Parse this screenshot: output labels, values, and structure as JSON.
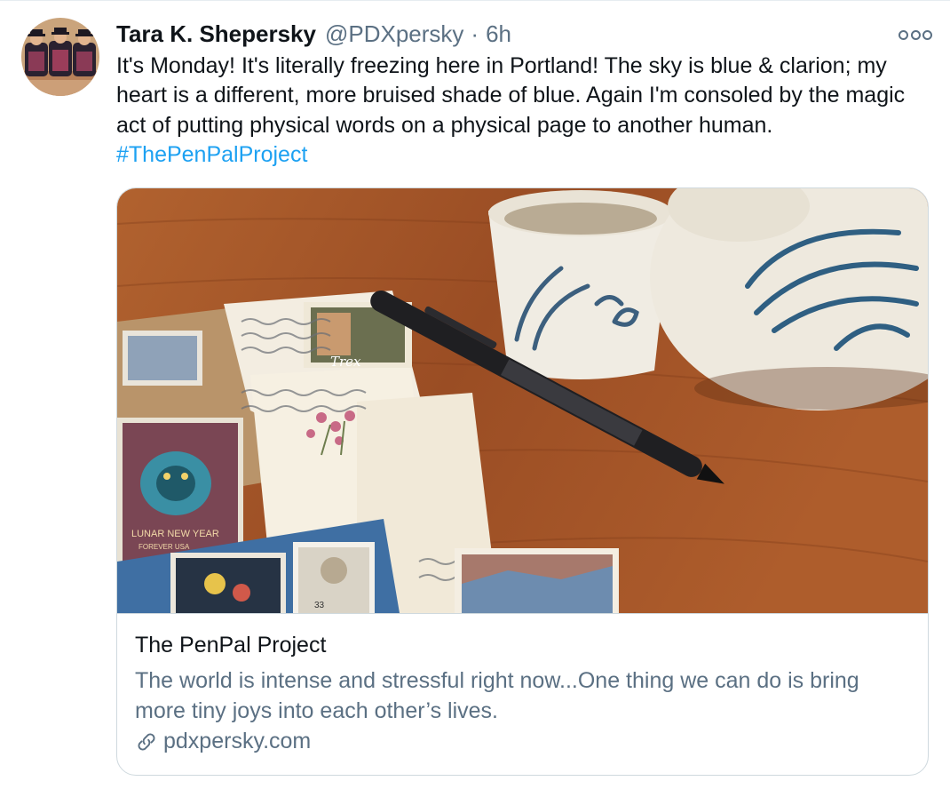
{
  "tweet": {
    "display_name": "Tara K. Shepersky",
    "handle": "@PDXpersky",
    "separator": "·",
    "timestamp": "6h",
    "text": "It's Monday! It's literally freezing here in Portland! The sky is blue & clarion; my heart is a different, more bruised shade of blue. Again I'm consoled by the magic act of putting physical words on a physical page to another human.",
    "hashtag": "#ThePenPalProject"
  },
  "card": {
    "title": "The PenPal Project",
    "description": "The world is intense and stressful right now...One thing we can do is bring more tiny joys into each other’s lives.",
    "domain": "pdxpersky.com",
    "image_text": {
      "stamp_lunar": "LUNAR NEW YEAR",
      "stamp_lunar_sub": "FOREVER USA",
      "stamp_price": "33",
      "stamp_word": "Trex"
    }
  },
  "icons": {
    "more": "more-horizontal-icon",
    "link": "link-icon"
  },
  "colors": {
    "text": "#0f1419",
    "secondary": "#5b7083",
    "accent": "#1da1f2",
    "border": "#cfd9de",
    "wood": "#a5562b"
  }
}
